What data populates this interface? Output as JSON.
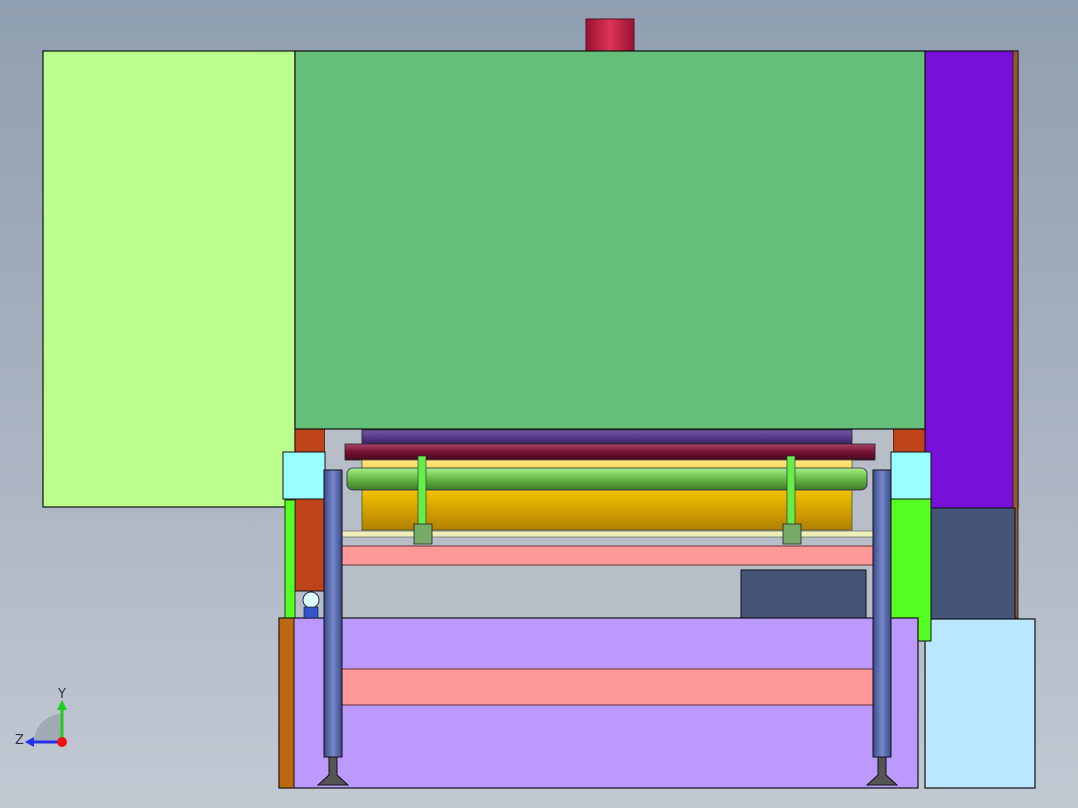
{
  "viewport": {
    "background_top": "#8f9eb0",
    "background_bottom": "#c2c9d3"
  },
  "triad": {
    "y_label": "Y",
    "z_label": "Z",
    "colors": {
      "y_axis": "#22cc22",
      "z_axis": "#2233ee",
      "x_origin": "#ee1111",
      "label": "#333344"
    }
  },
  "model": {
    "colors": {
      "left_panel": "#bbff8f",
      "main_panel": "#66bf78",
      "right_panel": "#7711d9",
      "top_cylinder": "#cc2244",
      "base_frame": "#bb99ff",
      "pink_bar": "#ff9999",
      "yellow_roller": "#e6b800",
      "green_roller": "#66bb44",
      "maroon_roller": "#771133",
      "blue_roller": "#55338a",
      "cyan_block": "#99ffff",
      "lime_block": "#55ff22",
      "slate_box": "#445577",
      "light_blue_box": "#bbe6ff",
      "orange_strip": "#bb6611",
      "support_post": "#5566aa"
    }
  }
}
